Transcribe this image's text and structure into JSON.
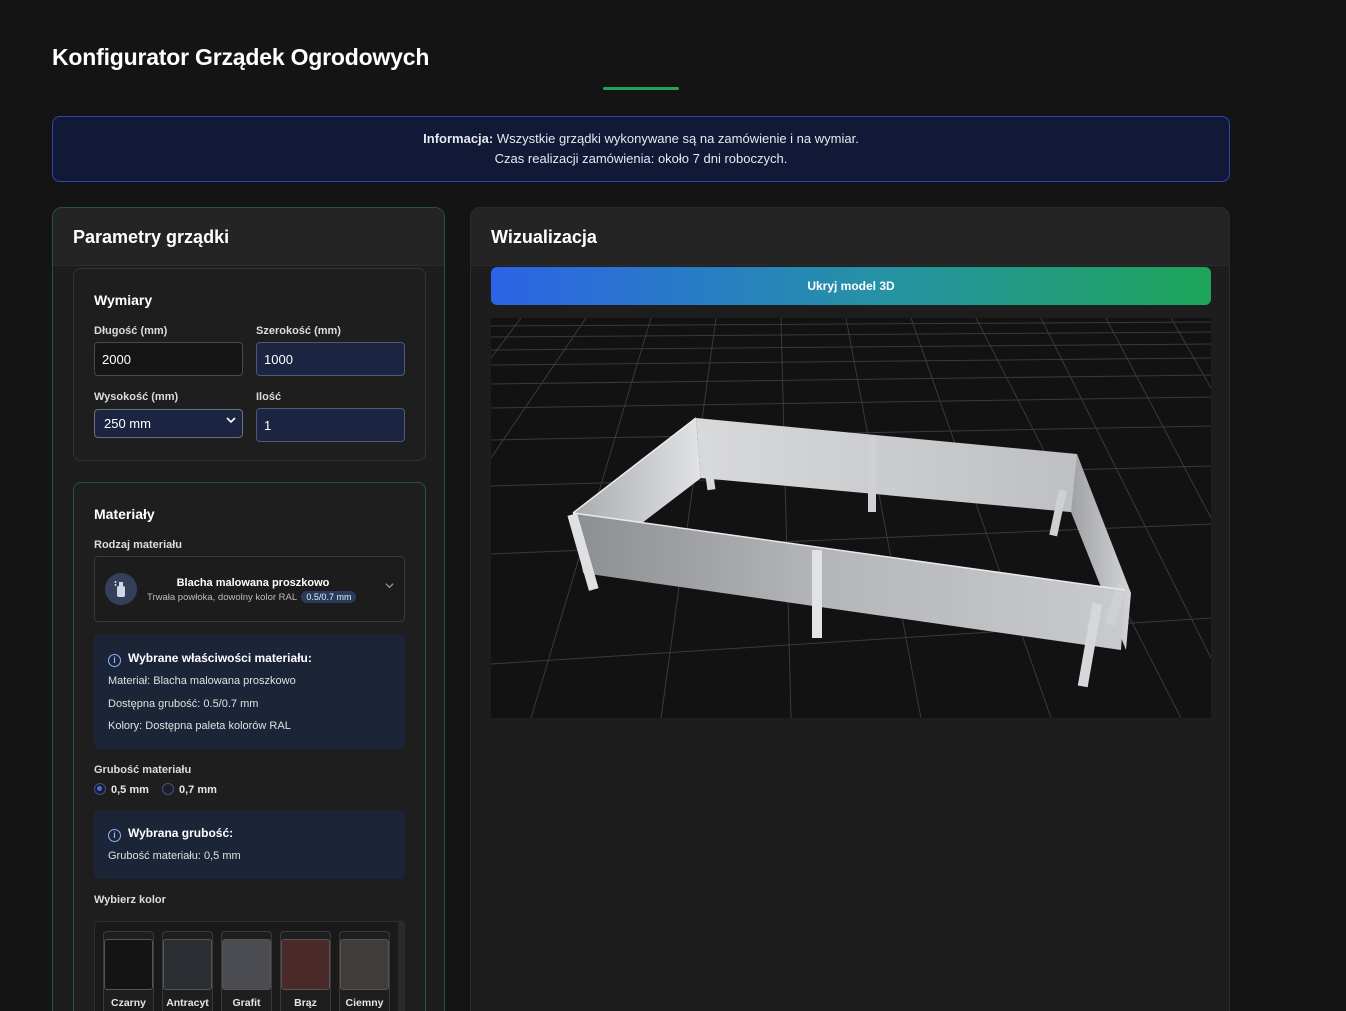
{
  "page": {
    "title": "Konfigurator Grządek Ogrodowych"
  },
  "banner": {
    "prefix": "Informacja:",
    "line1": " Wszystkie grządki wykonywane są na zamówienie i na wymiar.",
    "line2": "Czas realizacji zamówienia: około 7 dni roboczych."
  },
  "params": {
    "title": "Parametry grządki",
    "dimensions": {
      "title": "Wymiary",
      "length_label": "Długość (mm)",
      "length_value": "2000",
      "width_label": "Szerokość (mm)",
      "width_value": "1000",
      "height_label": "Wysokość (mm)",
      "height_value": "250 mm",
      "qty_label": "Ilość",
      "qty_value": "1"
    },
    "materials": {
      "title": "Materiały",
      "type_label": "Rodzaj materiału",
      "selected_name": "Blacha malowana proszkowo",
      "selected_desc": "Trwała powłoka, dowolny kolor RAL",
      "selected_badge": "0.5/0.7 mm",
      "selected_icon": "spray-can-icon",
      "props": {
        "title": "Wybrane właściwości materiału:",
        "line1": "Materiał: Blacha malowana proszkowo",
        "line2": "Dostępna grubość: 0.5/0.7 mm",
        "line3": "Kolory: Dostępna paleta kolorów RAL"
      },
      "thickness_label": "Grubość materiału",
      "thickness_options": [
        "0,5 mm",
        "0,7 mm"
      ],
      "thickness_selected": "0,5 mm",
      "thickness_info": {
        "title": "Wybrana grubość:",
        "line": "Grubość materiału: 0,5 mm"
      },
      "color_label": "Wybierz kolor",
      "colors": [
        {
          "name": "Czarny",
          "hex": "#141414"
        },
        {
          "name": "Antracyt",
          "hex": "#2a2d32"
        },
        {
          "name": "Grafit",
          "hex": "#4a4c52"
        },
        {
          "name": "Brąz",
          "hex": "#4a2a28"
        },
        {
          "name": "Ciemny",
          "hex": "#403c39"
        }
      ]
    }
  },
  "visual": {
    "title": "Wizualizacja",
    "toggle_label": "Ukryj model 3D"
  },
  "colors": {
    "accent_green": "#22a35a",
    "accent_blue": "#2c63e8",
    "banner_border": "#2f45b8"
  }
}
